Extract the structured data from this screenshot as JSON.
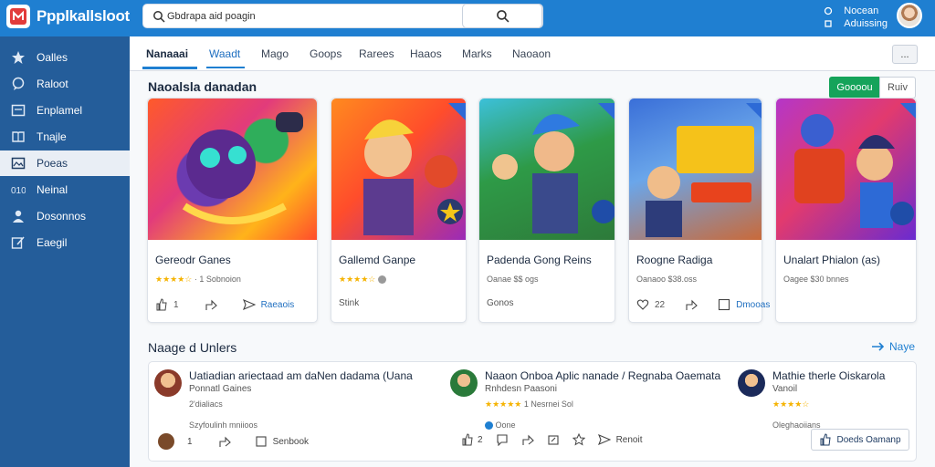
{
  "app": {
    "brand": "Ppplkallsloot",
    "accent": "#1f7fd1",
    "sidebar_bg": "#245d9a"
  },
  "search": {
    "value": "Gbdrapa aid poagin",
    "placeholder": ""
  },
  "top_right": {
    "line1": "Nocean",
    "line2": "Aduissing"
  },
  "sidebar": {
    "items": [
      {
        "label": "Oalles",
        "icon": "star-icon"
      },
      {
        "label": "Raloot",
        "icon": "chat-icon"
      },
      {
        "label": "Enplamel",
        "icon": "window-icon"
      },
      {
        "label": "Tnajle",
        "icon": "book-icon"
      },
      {
        "label": "Poeas",
        "icon": "image-icon"
      },
      {
        "label": "Neinal",
        "icon": "code-icon"
      },
      {
        "label": "Dosonnos",
        "icon": "user-icon"
      },
      {
        "label": "Eaegil",
        "icon": "edit-icon"
      }
    ]
  },
  "tabs": [
    {
      "label": "Nanaaai"
    },
    {
      "label": "Waadt"
    },
    {
      "label": "Mago"
    },
    {
      "label": "Goops"
    },
    {
      "label": "Rarees"
    },
    {
      "label": "Haaos"
    },
    {
      "label": "Marks"
    },
    {
      "label": "Naoaon"
    }
  ],
  "more_button": "...",
  "featured": {
    "title": "Naoalsla danadan",
    "green_button": "Goooou",
    "white_button": "Ruiv"
  },
  "cards": [
    {
      "title": "Gereodr Ganes",
      "meta_rating": "★★★★☆",
      "meta_text": "1 Sobnoion",
      "foot_count": "1",
      "foot_link": "Raeaois",
      "badge": ""
    },
    {
      "title": "Gallemd Ganpe",
      "meta_rating": "★★★★☆",
      "meta_text": "",
      "foot_count": "",
      "foot_link": "",
      "foot_text": "Stink",
      "badge": "no"
    },
    {
      "title": "Padenda Gong Reins",
      "meta_rating": "",
      "meta_text": "Oanae $$ ogs",
      "foot_count": "",
      "foot_link": "",
      "foot_text": "Gonos",
      "badge": "no"
    },
    {
      "title": "Roogne Radiga",
      "meta_rating": "",
      "meta_text": "Oanaoo $38.oss",
      "foot_count": "22",
      "foot_link": "Dmooas",
      "badge": "no"
    },
    {
      "title": "Unalart Phialon (as)",
      "meta_rating": "",
      "meta_text": "Oagee $30 bnnes",
      "foot_count": "",
      "foot_link": "",
      "badge": "no"
    }
  ],
  "lower": {
    "title": "Naage d Unlers",
    "view_more": "Naye",
    "entries": [
      {
        "title": "Uatiadian ariectaad am daNen dadama (Uana",
        "sub": "Ponnatl Gaines",
        "sub2": "2'dialiacs",
        "sub3": "Szyfoulinh mniioos",
        "foot_count": "1",
        "foot_link": "Senbook"
      },
      {
        "title": "Naaon Onboa Aplic nanade / Regnaba Oaemata",
        "sub": "Rnhdesn Paasoni",
        "rating": "★★★★★",
        "rating_text": "1 Nesrnei Sol",
        "sub3": "Oone",
        "foot_count": "2",
        "foot_link": "Renoit"
      },
      {
        "title": "Mathie therle Oiskarola",
        "sub": "Vanoil",
        "rating": "★★★★☆",
        "sub3": "Oleghaoiians",
        "button": "Doeds Oamanp"
      }
    ]
  }
}
